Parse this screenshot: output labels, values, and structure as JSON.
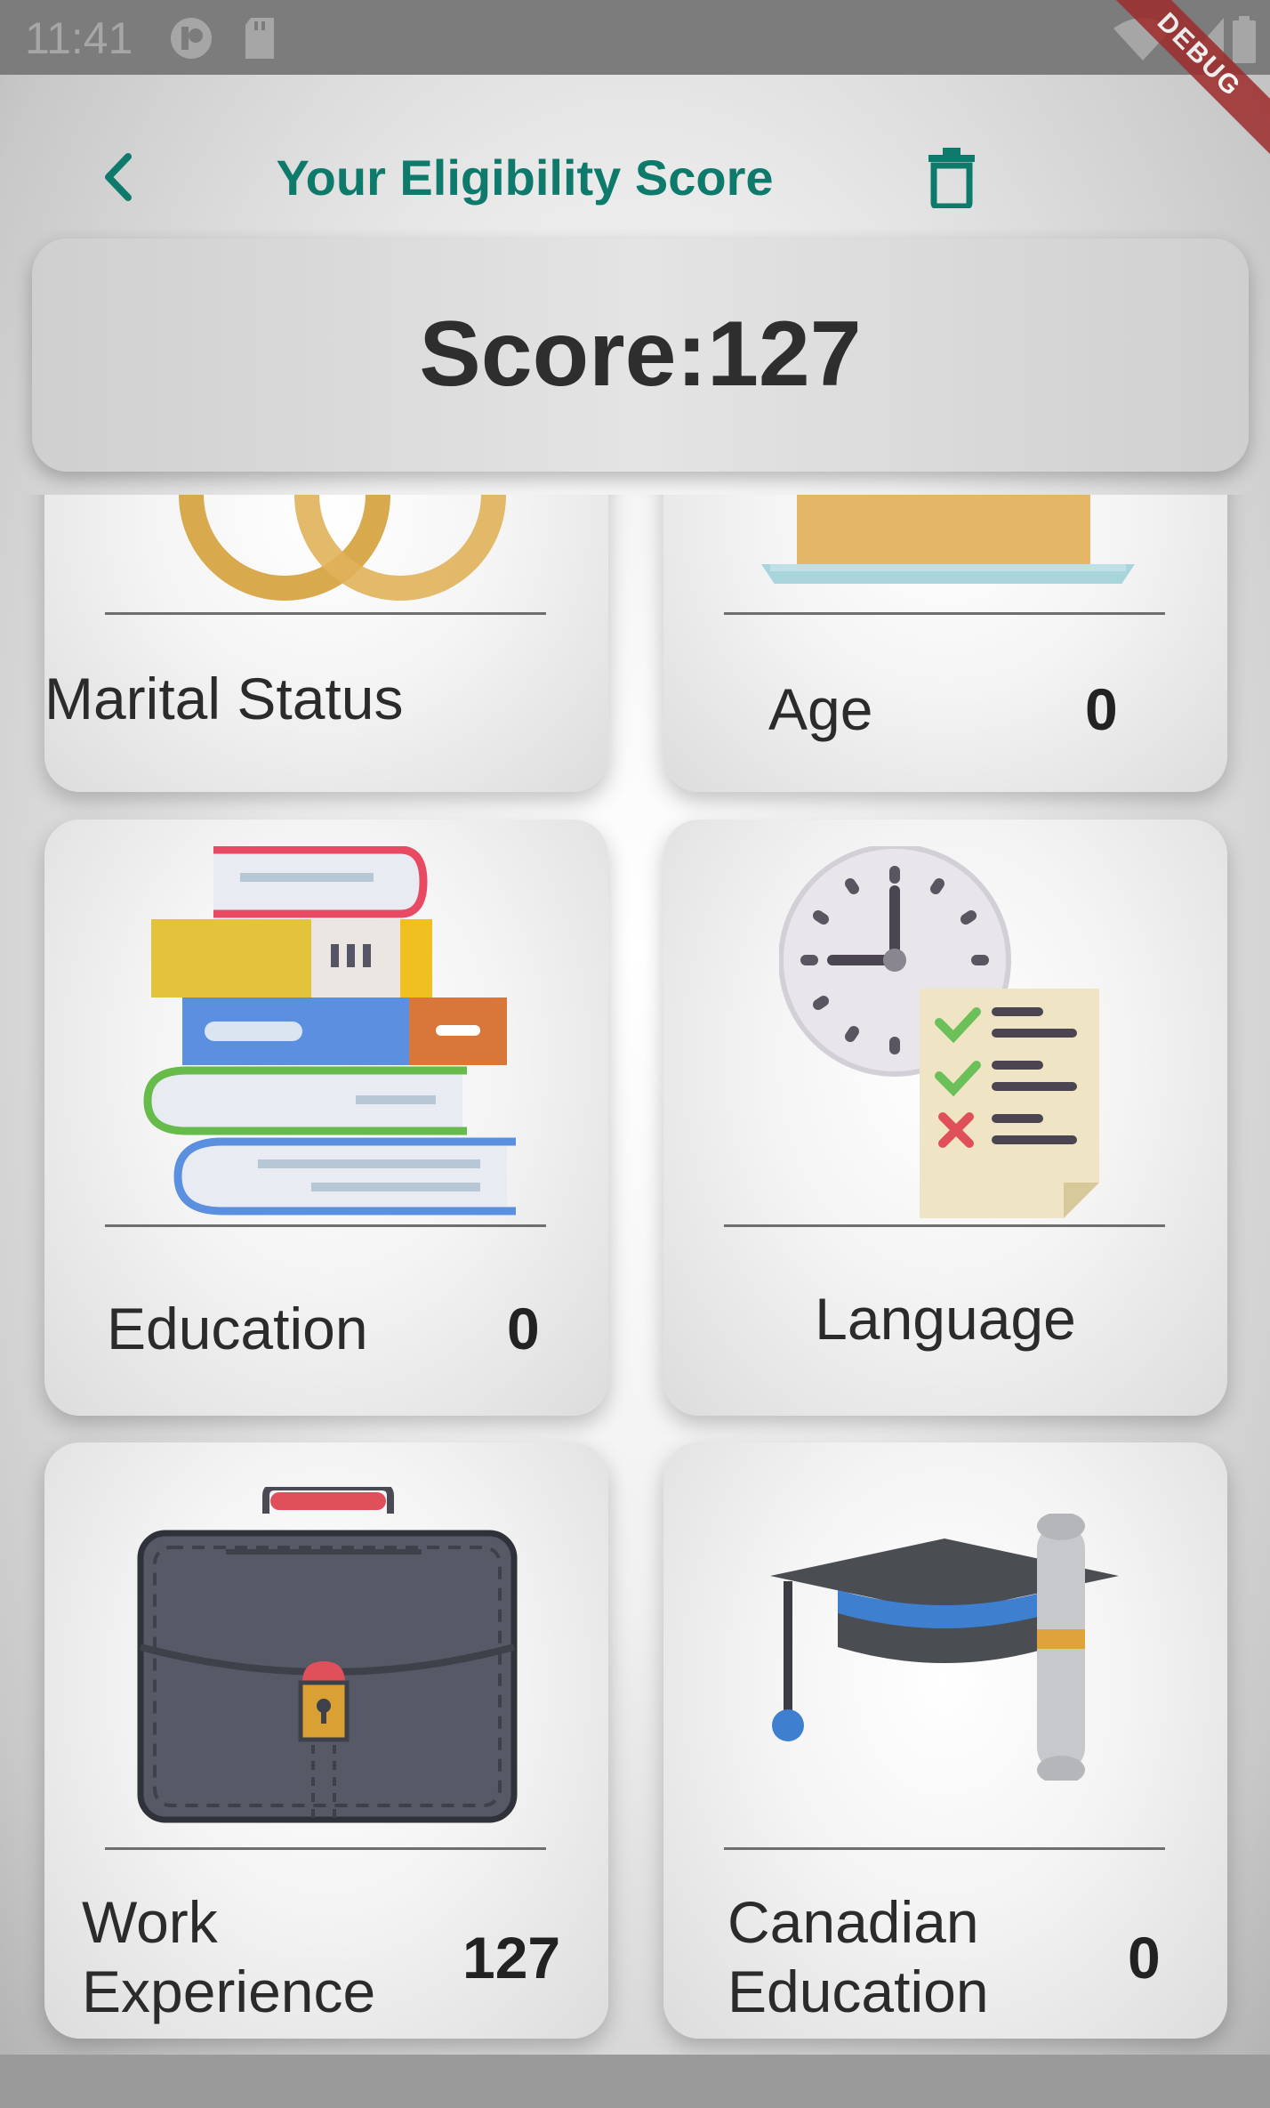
{
  "status_bar": {
    "time": "11:41",
    "debug_banner": "DEBUG"
  },
  "app_bar": {
    "title": "Your Eligibility Score"
  },
  "score_card": {
    "text": "Score:127"
  },
  "categories": [
    {
      "label": "Marital Status",
      "value": ""
    },
    {
      "label": "Age",
      "value": "0"
    },
    {
      "label": "Education",
      "value": "0"
    },
    {
      "label": "Language",
      "value": ""
    },
    {
      "label": "Work Experience",
      "value": "127"
    },
    {
      "label": "Canadian Education",
      "value": "0"
    }
  ],
  "colors": {
    "accent": "#0e7a6b",
    "score_text": "#2e2e2e",
    "debug": "#9e2b2b"
  }
}
